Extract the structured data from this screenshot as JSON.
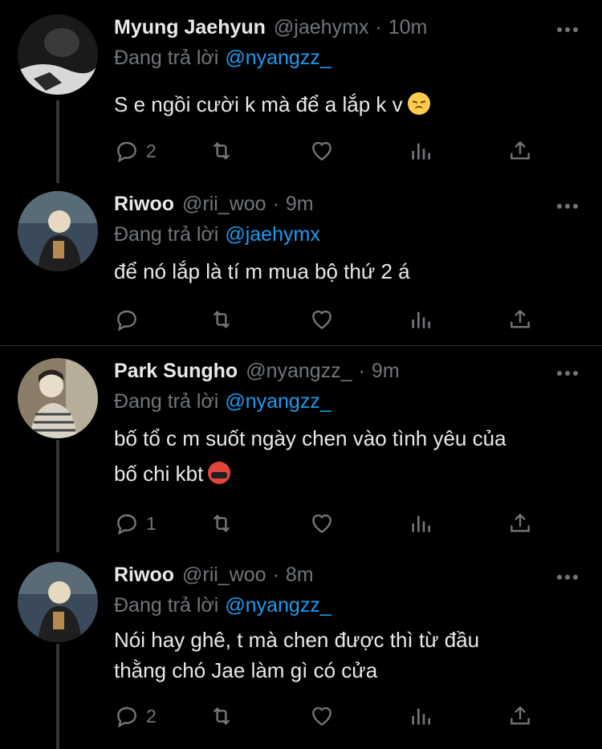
{
  "tweets": [
    {
      "name": "Myung Jaehyun",
      "handle": "@jaehymx",
      "dot": "·",
      "time": "10m",
      "reply_prefix": "Đang trả lời",
      "reply_to": "@nyangzz_",
      "text": "S e ngồi cười k mà để a lắp k v",
      "emoji": "disappointed-face",
      "reply_count": "2",
      "avatar_colors": [
        "#1a1a1a",
        "#cfcfcf"
      ]
    },
    {
      "name": "Riwoo",
      "handle": "@rii_woo",
      "dot": "·",
      "time": "9m",
      "reply_prefix": "Đang trả lời",
      "reply_to": "@jaehymx",
      "text": "để nó lắp là tí m mua bộ thứ 2 á",
      "reply_count": "",
      "avatar_colors": [
        "#3b4a5a",
        "#d9c7a5"
      ]
    },
    {
      "name": "Park Sungho",
      "handle": "@nyangzz_",
      "dot": "·",
      "time": "9m",
      "reply_prefix": "Đang trả lời",
      "reply_to": "@nyangzz_",
      "text_line1": "bố tổ c m suốt ngày chen vào tình yêu của",
      "text_line2": "bố chi kbt",
      "emoji": "face-with-symbols-on-mouth",
      "reply_count": "1",
      "avatar_colors": [
        "#9c8f7a",
        "#e8e1d6"
      ]
    },
    {
      "name": "Riwoo",
      "handle": "@rii_woo",
      "dot": "·",
      "time": "8m",
      "reply_prefix": "Đang trả lời",
      "reply_to": "@nyangzz_",
      "text_line1": "Nói hay ghê, t mà chen được thì từ đầu",
      "text_line2": "thằng chó Jae làm gì có cửa",
      "reply_count": "2",
      "avatar_colors": [
        "#3b4a5a",
        "#d9c7a5"
      ]
    }
  ],
  "colors": {
    "background": "#000000",
    "text": "#e7e9ea",
    "muted": "#71767b",
    "mention": "#1d9bf0",
    "thread_line": "#333639"
  },
  "icons": [
    "reply-icon",
    "retweet-icon",
    "like-icon",
    "views-icon",
    "share-icon",
    "more-icon"
  ]
}
